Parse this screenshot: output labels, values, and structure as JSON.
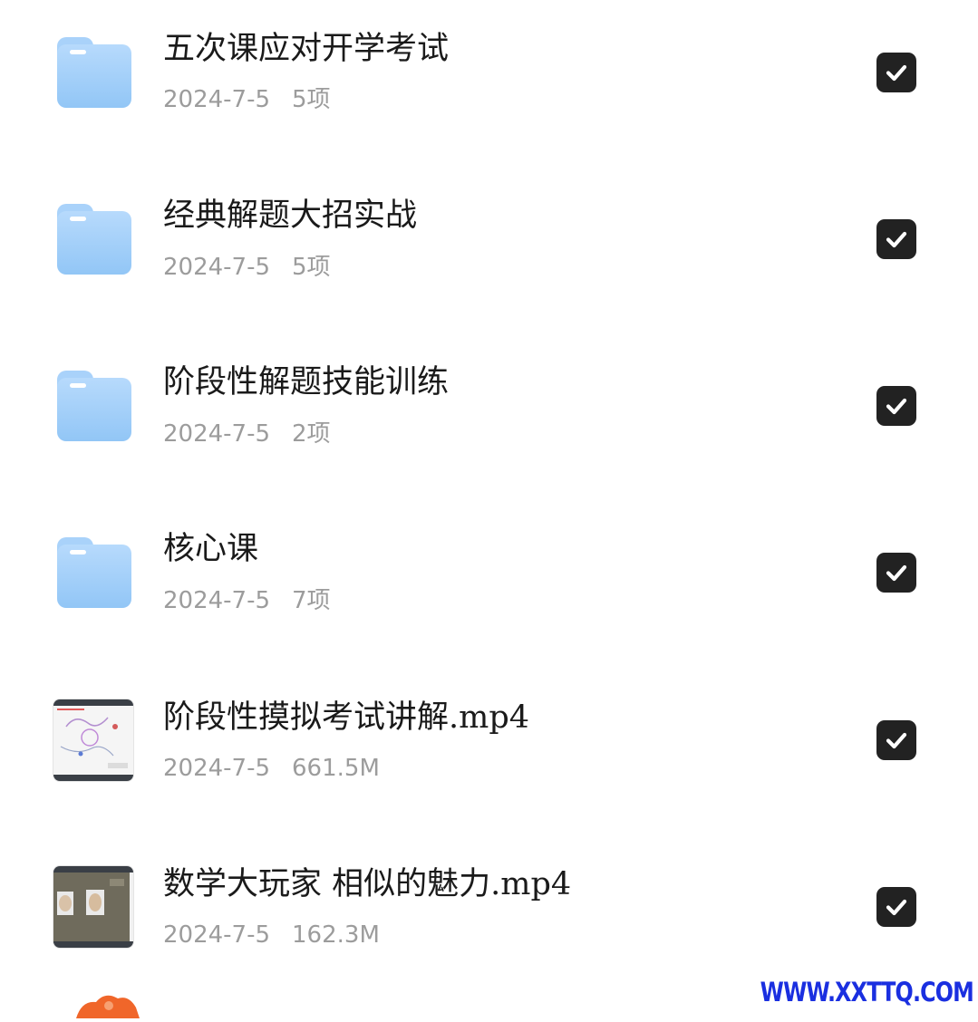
{
  "files": [
    {
      "type": "folder",
      "name": "五次课应对开学考试",
      "date": "2024-7-5",
      "info": "5项",
      "checked": true
    },
    {
      "type": "folder",
      "name": "经典解题大招实战",
      "date": "2024-7-5",
      "info": "5项",
      "checked": true
    },
    {
      "type": "folder",
      "name": "阶段性解题技能训练",
      "date": "2024-7-5",
      "info": "2项",
      "checked": true
    },
    {
      "type": "folder",
      "name": "核心课",
      "date": "2024-7-5",
      "info": "7项",
      "checked": true
    },
    {
      "type": "video",
      "name": "阶段性摸拟考试讲解.mp4",
      "date": "2024-7-5",
      "info": "661.5M",
      "checked": true
    },
    {
      "type": "video",
      "name": "数学大玩家 相似的魅力.mp4",
      "date": "2024-7-5",
      "info": "162.3M",
      "checked": true
    }
  ],
  "icons": {
    "folder": "folder-icon",
    "video": "video-thumbnail",
    "check": "checkbox-checked-icon"
  },
  "colors": {
    "folder": "#a9d2fa",
    "checkbox": "#222222",
    "meta_text": "#9c9c9c",
    "watermark": "#1a2fe0"
  },
  "watermark": "WWW.XXTTQ.COM"
}
